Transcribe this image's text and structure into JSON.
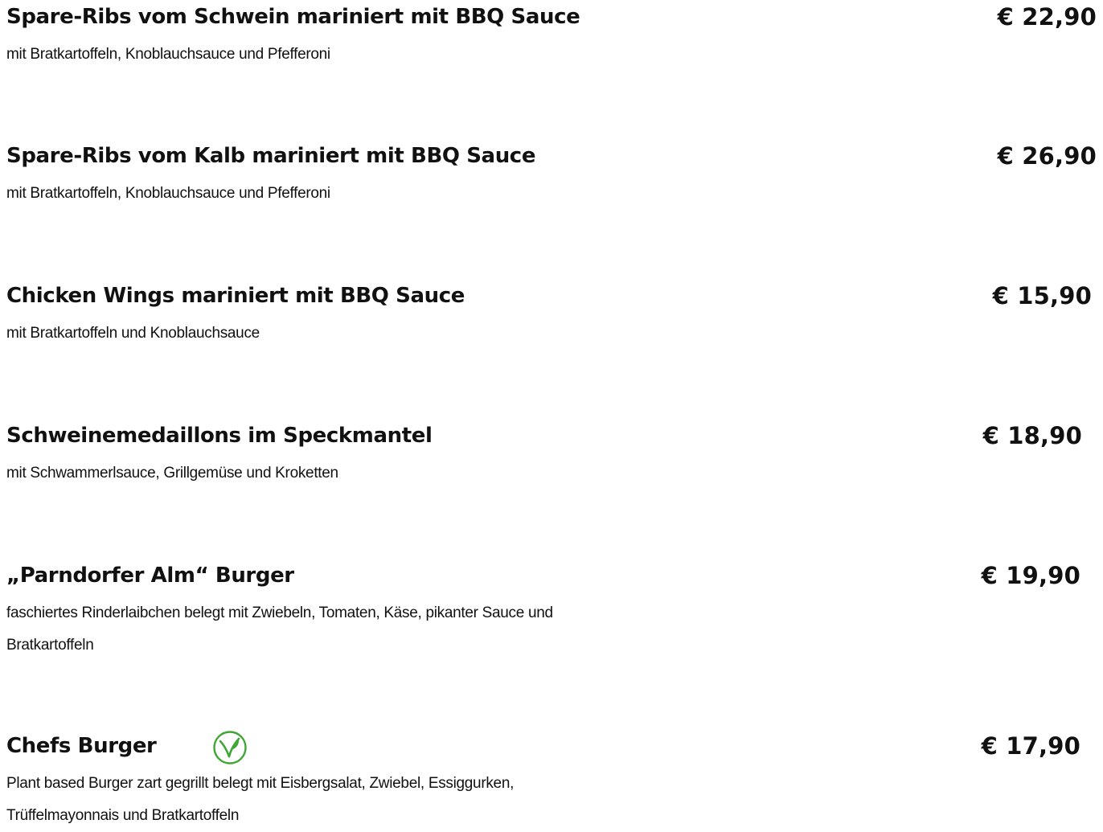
{
  "items": [
    {
      "title": "Spare-Ribs vom Schwein mariniert mit BBQ Sauce",
      "description": "mit Bratkartoffeln, Knoblauchsauce und Pfefferoni",
      "price": "€ 22,90"
    },
    {
      "title": "Spare-Ribs vom Kalb mariniert mit BBQ Sauce",
      "description": "mit Bratkartoffeln, Knoblauchsauce und Pfefferoni",
      "price": "€ 26,90"
    },
    {
      "title": "Chicken Wings mariniert mit BBQ Sauce",
      "description": "mit Bratkartoffeln und Knoblauchsauce",
      "price": "€ 15,90"
    },
    {
      "title": "Schweinemedaillons im Speckmantel",
      "description": "mit Schwammerlsauce, Grillgemüse und Kroketten",
      "price": "€ 18,90"
    },
    {
      "title": "„Parndorfer Alm“ Burger",
      "description": "faschiertes Rinderlaibchen belegt mit Zwiebeln, Tomaten, Käse, pikanter Sauce und Bratkartoffeln",
      "price": "€ 19,90"
    },
    {
      "title": "Chefs Burger",
      "description": "Plant based Burger zart gegrillt belegt mit Eisbergsalat, Zwiebel, Essiggurken, Trüffelmayonnais und Bratkartoffeln",
      "price": "€ 17,90",
      "icon": "vegan-icon"
    }
  ],
  "colors": {
    "text": "#111111",
    "vegan_green": "#3fa535",
    "background": "#ffffff"
  }
}
